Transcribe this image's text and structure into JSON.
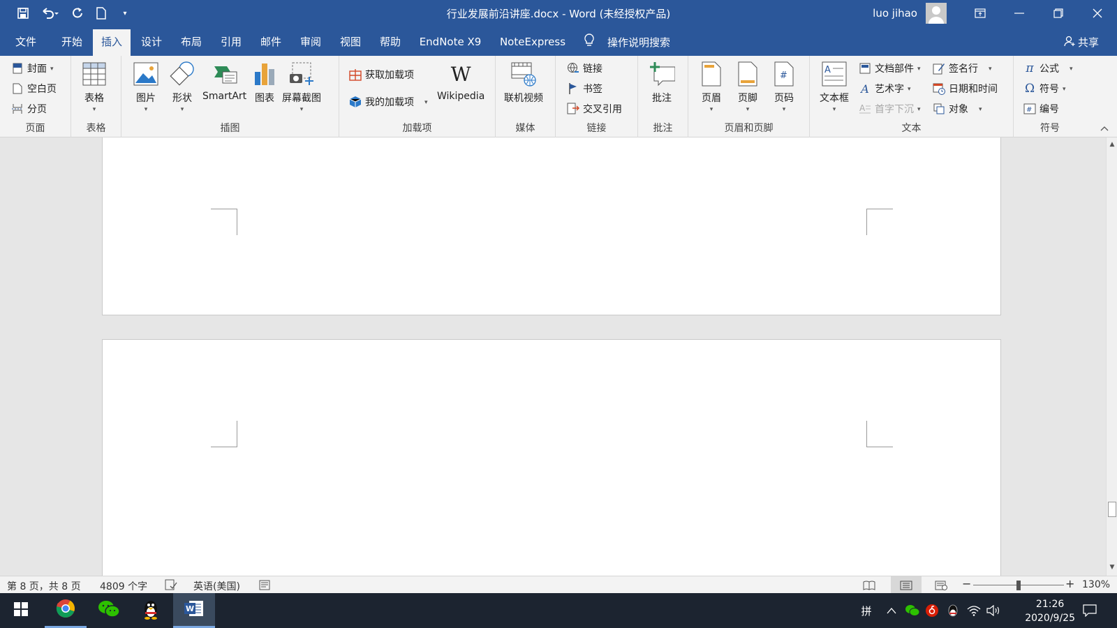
{
  "window": {
    "title": "行业发展前沿讲座.docx  -  Word (未经授权产品)",
    "user": "luo jihao"
  },
  "qat": {
    "save_icon": "save-icon",
    "undo_icon": "undo-icon",
    "redo_icon": "redo-icon",
    "new_icon": "new-document-icon"
  },
  "tabs": [
    {
      "label": "文件"
    },
    {
      "label": "开始"
    },
    {
      "label": "插入"
    },
    {
      "label": "设计"
    },
    {
      "label": "布局"
    },
    {
      "label": "引用"
    },
    {
      "label": "邮件"
    },
    {
      "label": "审阅"
    },
    {
      "label": "视图"
    },
    {
      "label": "帮助"
    },
    {
      "label": "EndNote X9"
    },
    {
      "label": "NoteExpress"
    }
  ],
  "active_tab": "插入",
  "search": {
    "label": "操作说明搜索"
  },
  "share": {
    "label": "共享"
  },
  "ribbon": {
    "pages": {
      "label": "页面",
      "cover": "封面",
      "blank": "空白页",
      "break": "分页"
    },
    "tables": {
      "label": "表格",
      "table": "表格"
    },
    "illustrations": {
      "label": "插图",
      "picture": "图片",
      "shapes": "形状",
      "smartart": "SmartArt",
      "chart": "图表",
      "screenshot": "屏幕截图"
    },
    "addins": {
      "label": "加载项",
      "get": "获取加载项",
      "my": "我的加载项",
      "wikipedia": "Wikipedia"
    },
    "media": {
      "label": "媒体",
      "video": "联机视频"
    },
    "links": {
      "label": "链接",
      "link": "链接",
      "bookmark": "书签",
      "crossref": "交叉引用"
    },
    "comments": {
      "label": "批注",
      "comment": "批注"
    },
    "headerfooter": {
      "label": "页眉和页脚",
      "header": "页眉",
      "footer": "页脚",
      "pagenum": "页码"
    },
    "text": {
      "label": "文本",
      "textbox": "文本框",
      "quickparts": "文档部件",
      "wordart": "艺术字",
      "dropcap": "首字下沉",
      "signature": "签名行",
      "datetime": "日期和时间",
      "object": "对象"
    },
    "symbols": {
      "label": "符号",
      "equation": "公式",
      "symbol": "符号",
      "number": "编号"
    }
  },
  "status": {
    "page": "第 8 页，共 8 页",
    "words": "4809 个字",
    "language": "英语(美国)",
    "zoom": "130%",
    "zoom_minus": "−",
    "zoom_plus": "+"
  },
  "taskbar": {
    "time": "21:26",
    "date": "2020/9/25",
    "ime": "拼"
  }
}
